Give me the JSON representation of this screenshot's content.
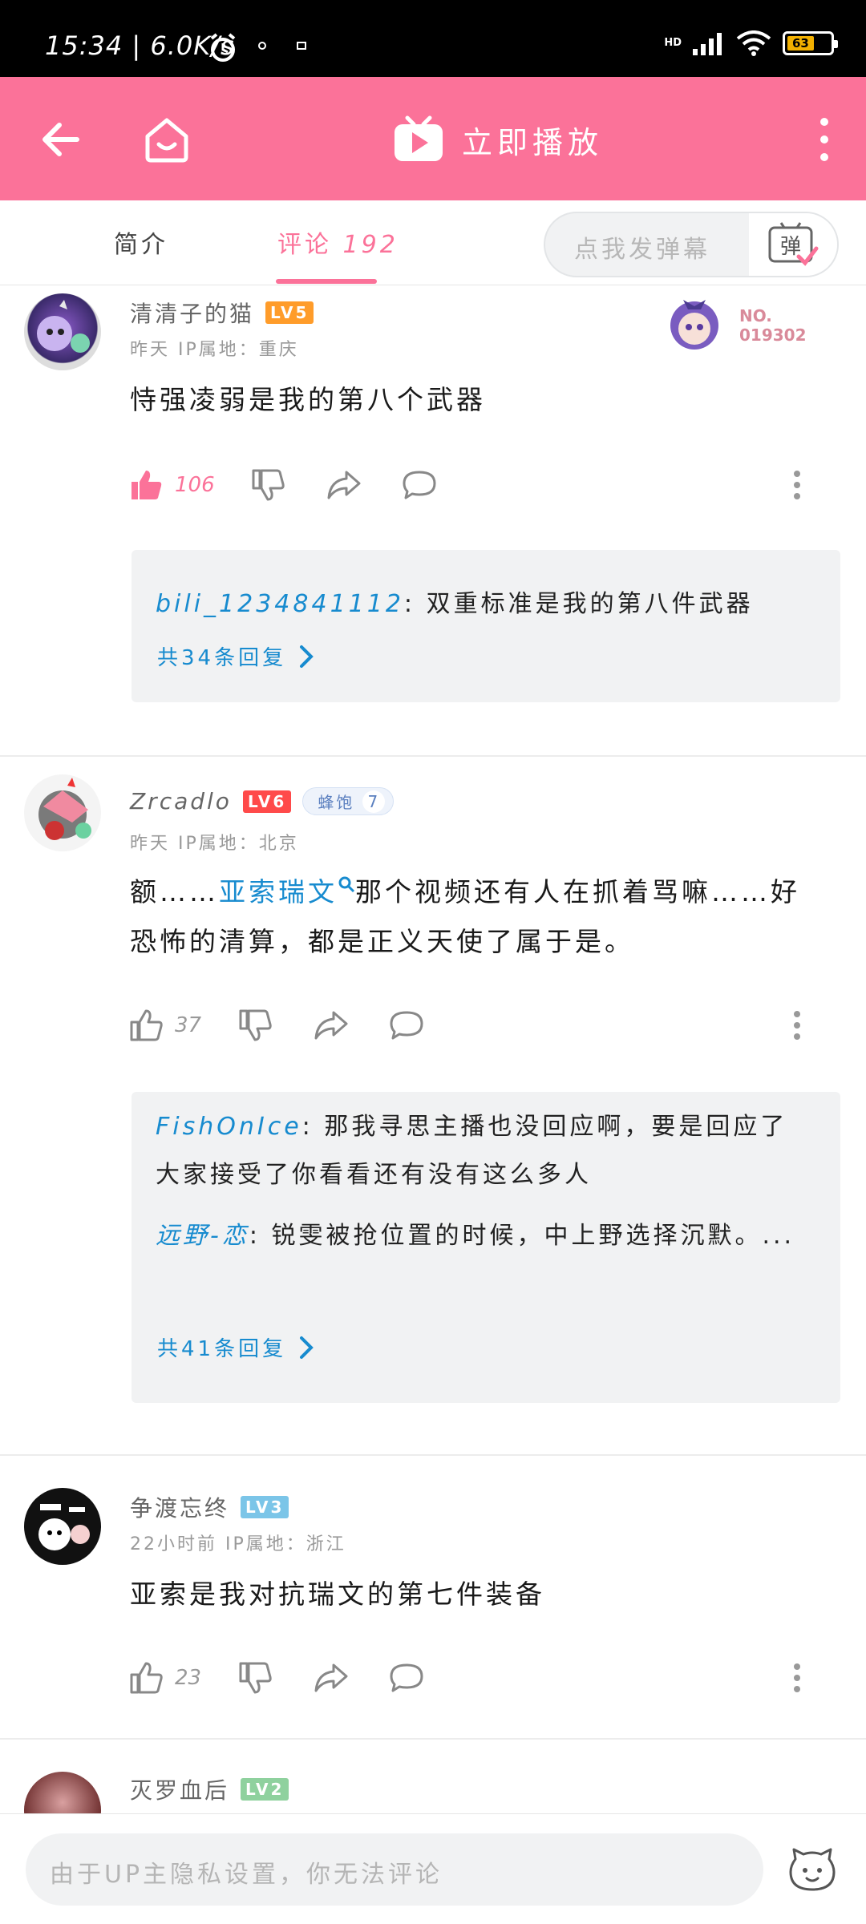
{
  "status_bar": {
    "time": "15:34",
    "speed": "6.0K/s",
    "network": "HD",
    "battery": "63"
  },
  "header": {
    "play_label": "立即播放"
  },
  "tabs": {
    "intro": "简介",
    "comments": "评论",
    "comment_count": "192",
    "danmaku_placeholder": "点我发弹幕",
    "danmaku_icon_label": "弹"
  },
  "comments": [
    {
      "username": "清清子的猫",
      "level": "LV5",
      "level_color": "#ff9c2a",
      "meta": "昨天 IP属地：重庆",
      "badge_no_label": "NO.",
      "badge_no": "019302",
      "text": "恃强凌弱是我的第八个武器",
      "likes": "106",
      "liked": true,
      "replies": [
        {
          "name": "bili_1234841112",
          "text": ": 双重标准是我的第八件武器"
        }
      ],
      "more_replies": "共34条回复"
    },
    {
      "username": "Zrcadlo",
      "level": "LV6",
      "level_color": "#ff4a4a",
      "fan_badge": "蜂饱",
      "fan_level": "7",
      "meta": "昨天 IP属地：北京",
      "text_pre": "额……",
      "text_link": "亚索瑞文",
      "text_post": "那个视频还有人在抓着骂嘛……好恐怖的清算，都是正义天使了属于是。",
      "likes": "37",
      "replies": [
        {
          "name": "FishOnIce",
          "text": ": 那我寻思主播也没回应啊，要是回应了大家接受了你看看还有没有这么多人"
        },
        {
          "name": "远野-恋",
          "text": ": 锐雯被抢位置的时候，中上野选择沉默。..."
        }
      ],
      "more_replies": "共41条回复"
    },
    {
      "username": "争渡忘终",
      "level": "LV3",
      "level_color": "#7bc5e8",
      "meta": "22小时前 IP属地：浙江",
      "text": "亚索是我对抗瑞文的第七件装备",
      "likes": "23"
    },
    {
      "username": "灭罗血后",
      "level": "LV2",
      "level_color": "#8fd19e"
    }
  ],
  "bottom_bar": {
    "placeholder": "由于UP主隐私设置，你无法评论"
  },
  "colors": {
    "brand_pink": "#fb7299",
    "link_blue": "#178bcf"
  }
}
